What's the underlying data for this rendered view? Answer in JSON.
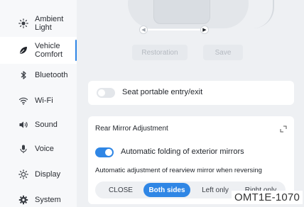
{
  "sidebar": {
    "items": [
      {
        "label": "Ambient Light",
        "icon": "sun-icon"
      },
      {
        "label": "Vehicle Comfort",
        "icon": "leaf-icon",
        "active": true
      },
      {
        "label": "Bluetooth",
        "icon": "bluetooth-icon"
      },
      {
        "label": "Wi-Fi",
        "icon": "wifi-icon"
      },
      {
        "label": "Sound",
        "icon": "speaker-icon"
      },
      {
        "label": "Voice",
        "icon": "microphone-icon"
      },
      {
        "label": "Display",
        "icon": "brightness-icon"
      },
      {
        "label": "System",
        "icon": "gear-icon"
      }
    ],
    "accent_color": "#2f86e5"
  },
  "seat": {
    "restoration_label": "Restoration",
    "save_label": "Save"
  },
  "portable_entry": {
    "label": "Seat portable entry/exit",
    "enabled": false
  },
  "rear_mirror": {
    "title": "Rear Mirror Adjustment",
    "auto_fold_label": "Automatic folding of exterior mirrors",
    "auto_fold_enabled": true,
    "reverse_adjust_label": "Automatic adjustment of rearview mirror when reversing",
    "options": [
      "CLOSE",
      "Both sides",
      "Left only",
      "Right only"
    ],
    "selected": "Both sides"
  },
  "watermark": "OMT1E-1070"
}
